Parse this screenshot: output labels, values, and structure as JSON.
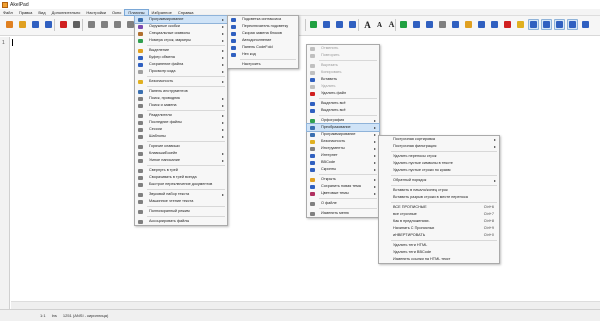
{
  "window": {
    "title": "AkelPad"
  },
  "menubar": [
    "Файл",
    "Правка",
    "Вид",
    "Дополнительно",
    "Настройки",
    "Окно",
    "Плагины",
    "Избранное",
    "Справка"
  ],
  "menubar_active": 6,
  "status": {
    "line": "1:1",
    "mode": "Ins",
    "codepage": "1251 (ANSI - кириллица)"
  },
  "gutter": {
    "line_no": "1"
  },
  "plugins_menu": [
    {
      "label": "Программирование",
      "arrow": true,
      "hl": true,
      "color": "#3a6fb0"
    },
    {
      "label": "Окружные скобки",
      "arrow": true,
      "color": "#7a4ab0"
    },
    {
      "label": "Специальные символы",
      "arrow": true,
      "color": "#b07030"
    },
    {
      "label": "Номера строк, маркеры",
      "arrow": true,
      "color": "#30a050"
    },
    {
      "sep": true
    },
    {
      "label": "Выделение",
      "arrow": true,
      "color": "#e0a020"
    },
    {
      "label": "Буфер обмена",
      "arrow": true,
      "color": "#3060c0"
    },
    {
      "label": "Сохранение файла",
      "arrow": true,
      "color": "#3060c0"
    },
    {
      "label": "Просмотр кода",
      "arrow": true,
      "color": "#a0a0a0"
    },
    {
      "sep": true
    },
    {
      "label": "Безопасность",
      "arrow": true,
      "color": "#e0b020"
    },
    {
      "sep": true
    },
    {
      "label": "Панель инструментов",
      "color": "#3a6fb0"
    },
    {
      "label": "Поиск, проводник",
      "arrow": true,
      "color": "#808080"
    },
    {
      "label": "Поиск и замена",
      "arrow": true,
      "color": "#808080"
    },
    {
      "sep": true
    },
    {
      "label": "Разделители",
      "arrow": true,
      "color": "#808080"
    },
    {
      "label": "Последние файлы",
      "arrow": true,
      "color": "#808080"
    },
    {
      "label": "Сессии",
      "arrow": true,
      "color": "#808080"
    },
    {
      "label": "Шаблоны",
      "arrow": true,
      "color": "#808080"
    },
    {
      "sep": true
    },
    {
      "label": "Горячие клавиши",
      "color": "#808080"
    },
    {
      "label": "КлавишиЕскейп",
      "arrow": true,
      "color": "#808080"
    },
    {
      "label": "Умное написание",
      "arrow": true,
      "color": "#808080"
    },
    {
      "sep": true
    },
    {
      "label": "Свернуть в трей",
      "color": "#808080"
    },
    {
      "label": "Сворачивать в трей всегда",
      "color": "#808080"
    },
    {
      "label": "Быстрое переключение документов",
      "color": "#808080"
    },
    {
      "sep": true
    },
    {
      "label": "Звуковой набор текста",
      "arrow": true,
      "color": "#808080"
    },
    {
      "label": "Машинное чтение текста",
      "color": "#808080"
    },
    {
      "sep": true
    },
    {
      "label": "Полноэкранный режим",
      "color": "#808080"
    },
    {
      "sep": true
    },
    {
      "label": "Ассоциировать файлы",
      "color": "#808080"
    }
  ],
  "prog_submenu": [
    {
      "label": "Подсветка синтаксиса",
      "color": "#3060c0"
    },
    {
      "label": "Переключатель подсветку",
      "color": "#3060c0"
    },
    {
      "label": "Скорая замена блоков",
      "color": "#3060c0"
    },
    {
      "label": "Автодополнение",
      "color": "#3060c0"
    },
    {
      "label": "Панель CodeFold",
      "color": "#3060c0"
    },
    {
      "label": "Hex код",
      "color": "#3060c0"
    },
    {
      "sep": true
    },
    {
      "label": "Настроить"
    }
  ],
  "context_menu": [
    {
      "label": "Отменить",
      "dim": true,
      "color": "#c0c0c0"
    },
    {
      "label": "Повторить",
      "dim": true,
      "color": "#c0c0c0"
    },
    {
      "sep": true
    },
    {
      "label": "Вырезать",
      "dim": true,
      "color": "#c0c0c0"
    },
    {
      "label": "Копировать",
      "dim": true,
      "color": "#c0c0c0"
    },
    {
      "label": "Вставить",
      "color": "#3060c0"
    },
    {
      "label": "Удалить",
      "dim": true,
      "color": "#c0c0c0"
    },
    {
      "label": "Удалить файл",
      "color": "#d02020"
    },
    {
      "sep": true
    },
    {
      "label": "Выделить всё",
      "color": "#3060c0"
    },
    {
      "label": "Выделить всё",
      "color": "#3060c0"
    },
    {
      "sep": true
    },
    {
      "label": "Орфография",
      "arrow": true,
      "color": "#30a050"
    },
    {
      "label": "Преобразование",
      "arrow": true,
      "hl": true,
      "color": "#3a6fb0"
    },
    {
      "label": "Программирование",
      "arrow": true,
      "color": "#3a6fb0"
    },
    {
      "label": "Безопасность",
      "arrow": true,
      "color": "#e0b020"
    },
    {
      "label": "Инструменты",
      "arrow": true,
      "color": "#808080"
    },
    {
      "label": "Интернет",
      "arrow": true,
      "color": "#3060c0"
    },
    {
      "label": "BBCode",
      "arrow": true,
      "color": "#3060c0"
    },
    {
      "label": "Скрипты",
      "arrow": true,
      "color": "#3060c0"
    },
    {
      "sep": true
    },
    {
      "label": "Открыть",
      "arrow": true,
      "color": "#e0a020"
    },
    {
      "label": "Сохранить новая тема",
      "arrow": true,
      "color": "#3060c0"
    },
    {
      "label": "Цветовые темы",
      "arrow": true,
      "color": "#b03060"
    },
    {
      "sep": true
    },
    {
      "label": "О файле",
      "color": "#808080"
    },
    {
      "sep": true
    },
    {
      "label": "Изменить меню",
      "color": "#808080"
    }
  ],
  "convert_submenu": [
    {
      "label": "Построчная сортировка",
      "arrow": true
    },
    {
      "label": "Построчная фильтрация",
      "arrow": true
    },
    {
      "sep": true
    },
    {
      "label": "Удалить переносы строк"
    },
    {
      "label": "Удалить пустые символы в тексте"
    },
    {
      "label": "Удалить пустые строки по краям"
    },
    {
      "sep": true
    },
    {
      "label": "Обратный порядок",
      "arrow": true
    },
    {
      "sep": true
    },
    {
      "label": "Вставить в начало/конец строк"
    },
    {
      "label": "Вставить разрыв строки в месте переноса"
    },
    {
      "sep": true
    },
    {
      "label": "ВСЕ ПРОПИСНЫЕ",
      "sc": "Ctrl+6"
    },
    {
      "label": "все строчные",
      "sc": "Ctrl+7"
    },
    {
      "label": "Как в предложениях.",
      "sc": "Ctrl+8"
    },
    {
      "label": "Начинать С Прописных",
      "sc": "Ctrl+9"
    },
    {
      "label": "иНВЕРТИРОВАТЬ",
      "sc": "Ctrl+0"
    },
    {
      "sep": true
    },
    {
      "label": "Удалить теги HTML"
    },
    {
      "label": "Удалить теги BBCode"
    },
    {
      "label": "Изменить ссылки на HTML текст"
    }
  ]
}
